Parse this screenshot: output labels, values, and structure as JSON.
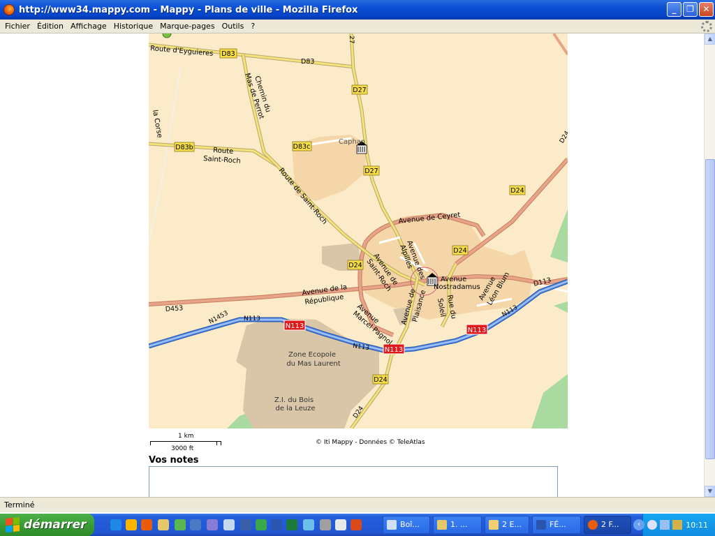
{
  "window": {
    "title": "http://www34.mappy.com - Mappy - Plans de ville - Mozilla Firefox",
    "buttons": {
      "minimize": "_",
      "maximize": "❐",
      "close": "✕"
    }
  },
  "menu": [
    "Fichier",
    "Édition",
    "Affichage",
    "Historique",
    "Marque-pages",
    "Outils",
    "?"
  ],
  "map": {
    "labels": {
      "route_eyguieres": "Route d'Eyguieres",
      "chemin_mas_perrot_1": "Chemin du",
      "chemin_mas_perrot_2": "Mas de Perrot",
      "route_saint_roch_1": "Route",
      "route_saint_roch_2": "Saint-Roch",
      "route_de_saint_roch": "Route de Saint-Roch",
      "la_corse": "la Corse",
      "caphan": "Caphan",
      "avenue_de_ceyret": "Avenue de Ceyret",
      "avenue_des_alpilles_1": "Avenue des",
      "avenue_des_alpilles_2": "Alpilles",
      "avenue_de_saint_roch_1": "Avenue de",
      "avenue_de_saint_roch_2": "Saint-Roch",
      "avenue_nostradamus_1": "Avenue",
      "avenue_nostradamus_2": "Nostradamus",
      "avenue_leon_blum_1": "Avenue",
      "avenue_leon_blum_2": "Léon Blum",
      "avenue_republique_1": "Avenue de la",
      "avenue_republique_2": "République",
      "avenue_marcel_pagnol_1": "Avenue",
      "avenue_marcel_pagnol_2": "Marcel Pagnol",
      "avenue_plaisance_1": "Avenue de",
      "avenue_plaisance_2": "Plaisance",
      "rue_du_soleil_1": "Rue du",
      "rue_du_soleil_2": "Soleil",
      "zone_ecopole_1": "Zone Ecopole",
      "zone_ecopole_2": "du Mas Laurent",
      "zi_bois_1": "Z.I. du Bois",
      "zi_bois_2": "de la Leuze",
      "n113_small_1": "N113",
      "n113_small_2": "N113",
      "n113_small_3": "N113",
      "n1453": "N1453"
    },
    "shields": {
      "d83_a": "D83",
      "d83_b": "D83",
      "d27_a": "D27",
      "d27_b": "D27",
      "d27_top": "27",
      "d83b": "D83b",
      "d83c": "D83c",
      "d24_a": "D24",
      "d24_b": "D24",
      "d24_c": "D24",
      "d24_d": "D24",
      "d24_e": "D24",
      "d24_f": "D24",
      "d453": "D453",
      "d113": "D113",
      "n113_a": "N113",
      "n113_b": "N113",
      "n113_c": "N113"
    },
    "colors": {
      "background": "#fbebc8",
      "urban": "#f5d6a8",
      "industrial": "#d9c6a8",
      "park": "#a9dba0",
      "road_main": "#e08c6c",
      "road_secondary": "#f4e27a",
      "highway": "#4f86e6",
      "shield_yellow": "#f6dc45",
      "shield_red": "#e01818"
    }
  },
  "scale": {
    "metric": "1 km",
    "imperial": "3000 ft"
  },
  "credits": "© Iti Mappy - Données © TeleAtlas",
  "notes": {
    "title": "Vos notes",
    "value": ""
  },
  "status": "Terminé",
  "taskbar": {
    "start_label": "démarrer",
    "tasks": [
      "Boî...",
      "1. ...",
      "2 E...",
      "FÉ...",
      "2 F..."
    ],
    "clock": "10:11"
  }
}
